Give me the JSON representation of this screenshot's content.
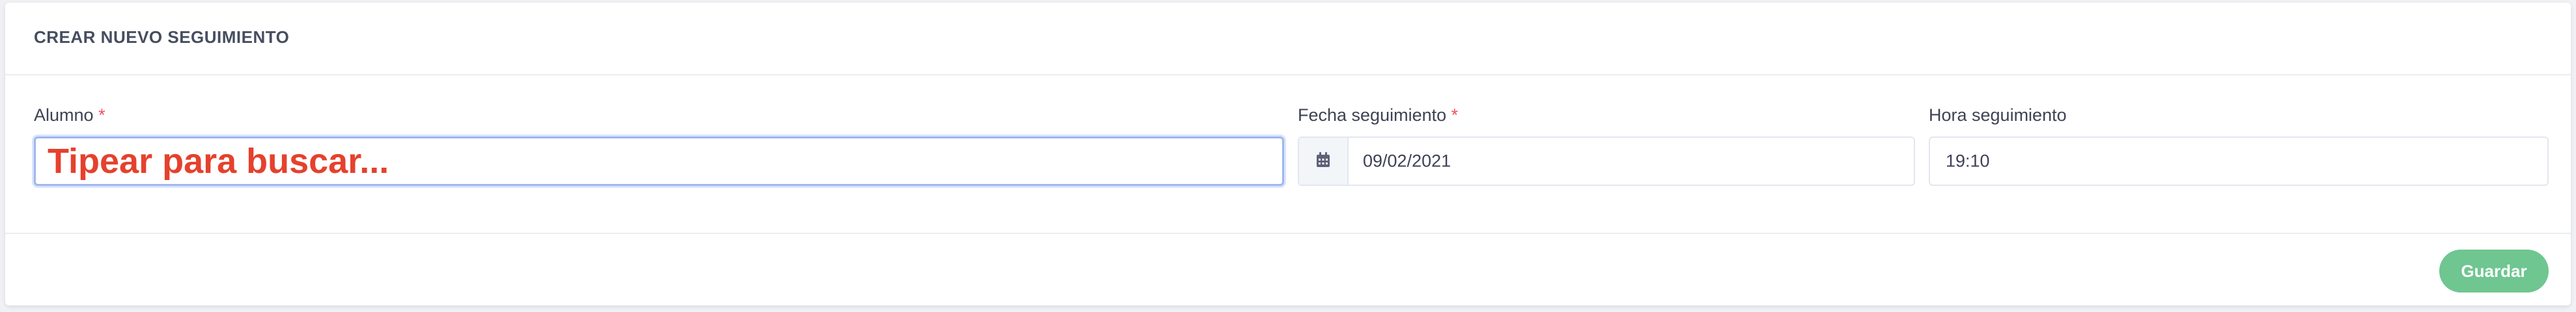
{
  "card": {
    "title": "CREAR NUEVO SEGUIMIENTO"
  },
  "form": {
    "alumno": {
      "label": "Alumno",
      "required": "*",
      "placeholder": "Tipear para buscar..."
    },
    "fecha": {
      "label": "Fecha seguimiento",
      "required": "*",
      "value": "09/02/2021",
      "icon": "calendar-icon"
    },
    "hora": {
      "label": "Hora seguimiento",
      "value": "19:10"
    }
  },
  "footer": {
    "save_label": "Guardar"
  },
  "colors": {
    "accent": "#6fc690",
    "required": "#f64e60",
    "focus": "#9fb7ec",
    "placeholder": "#e5412d"
  }
}
